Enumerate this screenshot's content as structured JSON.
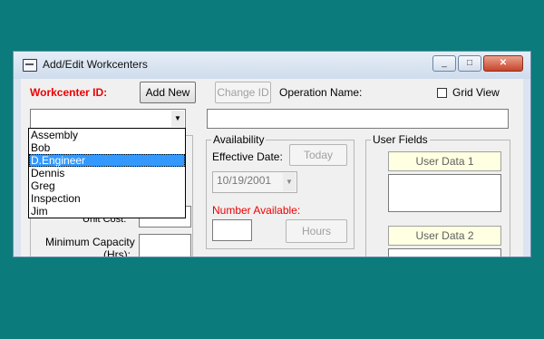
{
  "window": {
    "title": "Add/Edit Workcenters",
    "minimize": "_",
    "maximize": "□",
    "close": "✕"
  },
  "header": {
    "workcenter_label": "Workcenter ID:",
    "add_new": "Add New",
    "change_id": "Change ID",
    "operation_name_label": "Operation Name:",
    "grid_view_label": "Grid View",
    "workcenter_value": "",
    "operation_name_value": ""
  },
  "dropdown": {
    "items": [
      "Assembly",
      "Bob",
      "D.Engineer",
      "Dennis",
      "Greg",
      "Inspection",
      "Jim"
    ],
    "selected": "D.Engineer"
  },
  "left": {
    "unit_cost_label": "Unit Cost:",
    "min_capacity_label": "Minimum Capacity",
    "min_capacity_unit": "(Hrs):"
  },
  "availability": {
    "title": "Availability",
    "effective_date_label": "Effective Date:",
    "today_btn": "Today",
    "date_value": "10/19/2001",
    "number_available_label": "Number Available:",
    "hours_btn": "Hours"
  },
  "user_fields": {
    "title": "User Fields",
    "user_data_1": "User Data 1",
    "user_data_2": "User Data 2"
  },
  "colors": {
    "background": "#0b7b7b",
    "required_label": "#e00000",
    "selection": "#3399ff",
    "user_data_bg": "#ffffe1"
  }
}
